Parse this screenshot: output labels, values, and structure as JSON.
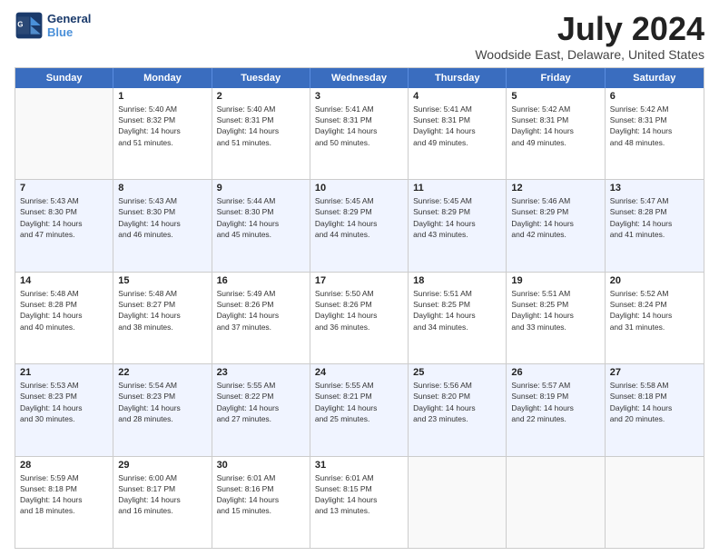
{
  "logo": {
    "line1": "General",
    "line2": "Blue"
  },
  "title": "July 2024",
  "subtitle": "Woodside East, Delaware, United States",
  "days_of_week": [
    "Sunday",
    "Monday",
    "Tuesday",
    "Wednesday",
    "Thursday",
    "Friday",
    "Saturday"
  ],
  "weeks": [
    [
      {
        "day": "",
        "sunrise": "",
        "sunset": "",
        "daylight": "",
        "empty": true
      },
      {
        "day": "1",
        "sunrise": "Sunrise: 5:40 AM",
        "sunset": "Sunset: 8:32 PM",
        "daylight": "Daylight: 14 hours",
        "dl2": "and 51 minutes."
      },
      {
        "day": "2",
        "sunrise": "Sunrise: 5:40 AM",
        "sunset": "Sunset: 8:31 PM",
        "daylight": "Daylight: 14 hours",
        "dl2": "and 51 minutes."
      },
      {
        "day": "3",
        "sunrise": "Sunrise: 5:41 AM",
        "sunset": "Sunset: 8:31 PM",
        "daylight": "Daylight: 14 hours",
        "dl2": "and 50 minutes."
      },
      {
        "day": "4",
        "sunrise": "Sunrise: 5:41 AM",
        "sunset": "Sunset: 8:31 PM",
        "daylight": "Daylight: 14 hours",
        "dl2": "and 49 minutes."
      },
      {
        "day": "5",
        "sunrise": "Sunrise: 5:42 AM",
        "sunset": "Sunset: 8:31 PM",
        "daylight": "Daylight: 14 hours",
        "dl2": "and 49 minutes."
      },
      {
        "day": "6",
        "sunrise": "Sunrise: 5:42 AM",
        "sunset": "Sunset: 8:31 PM",
        "daylight": "Daylight: 14 hours",
        "dl2": "and 48 minutes."
      }
    ],
    [
      {
        "day": "7",
        "sunrise": "Sunrise: 5:43 AM",
        "sunset": "Sunset: 8:30 PM",
        "daylight": "Daylight: 14 hours",
        "dl2": "and 47 minutes."
      },
      {
        "day": "8",
        "sunrise": "Sunrise: 5:43 AM",
        "sunset": "Sunset: 8:30 PM",
        "daylight": "Daylight: 14 hours",
        "dl2": "and 46 minutes."
      },
      {
        "day": "9",
        "sunrise": "Sunrise: 5:44 AM",
        "sunset": "Sunset: 8:30 PM",
        "daylight": "Daylight: 14 hours",
        "dl2": "and 45 minutes."
      },
      {
        "day": "10",
        "sunrise": "Sunrise: 5:45 AM",
        "sunset": "Sunset: 8:29 PM",
        "daylight": "Daylight: 14 hours",
        "dl2": "and 44 minutes."
      },
      {
        "day": "11",
        "sunrise": "Sunrise: 5:45 AM",
        "sunset": "Sunset: 8:29 PM",
        "daylight": "Daylight: 14 hours",
        "dl2": "and 43 minutes."
      },
      {
        "day": "12",
        "sunrise": "Sunrise: 5:46 AM",
        "sunset": "Sunset: 8:29 PM",
        "daylight": "Daylight: 14 hours",
        "dl2": "and 42 minutes."
      },
      {
        "day": "13",
        "sunrise": "Sunrise: 5:47 AM",
        "sunset": "Sunset: 8:28 PM",
        "daylight": "Daylight: 14 hours",
        "dl2": "and 41 minutes."
      }
    ],
    [
      {
        "day": "14",
        "sunrise": "Sunrise: 5:48 AM",
        "sunset": "Sunset: 8:28 PM",
        "daylight": "Daylight: 14 hours",
        "dl2": "and 40 minutes."
      },
      {
        "day": "15",
        "sunrise": "Sunrise: 5:48 AM",
        "sunset": "Sunset: 8:27 PM",
        "daylight": "Daylight: 14 hours",
        "dl2": "and 38 minutes."
      },
      {
        "day": "16",
        "sunrise": "Sunrise: 5:49 AM",
        "sunset": "Sunset: 8:26 PM",
        "daylight": "Daylight: 14 hours",
        "dl2": "and 37 minutes."
      },
      {
        "day": "17",
        "sunrise": "Sunrise: 5:50 AM",
        "sunset": "Sunset: 8:26 PM",
        "daylight": "Daylight: 14 hours",
        "dl2": "and 36 minutes."
      },
      {
        "day": "18",
        "sunrise": "Sunrise: 5:51 AM",
        "sunset": "Sunset: 8:25 PM",
        "daylight": "Daylight: 14 hours",
        "dl2": "and 34 minutes."
      },
      {
        "day": "19",
        "sunrise": "Sunrise: 5:51 AM",
        "sunset": "Sunset: 8:25 PM",
        "daylight": "Daylight: 14 hours",
        "dl2": "and 33 minutes."
      },
      {
        "day": "20",
        "sunrise": "Sunrise: 5:52 AM",
        "sunset": "Sunset: 8:24 PM",
        "daylight": "Daylight: 14 hours",
        "dl2": "and 31 minutes."
      }
    ],
    [
      {
        "day": "21",
        "sunrise": "Sunrise: 5:53 AM",
        "sunset": "Sunset: 8:23 PM",
        "daylight": "Daylight: 14 hours",
        "dl2": "and 30 minutes."
      },
      {
        "day": "22",
        "sunrise": "Sunrise: 5:54 AM",
        "sunset": "Sunset: 8:23 PM",
        "daylight": "Daylight: 14 hours",
        "dl2": "and 28 minutes."
      },
      {
        "day": "23",
        "sunrise": "Sunrise: 5:55 AM",
        "sunset": "Sunset: 8:22 PM",
        "daylight": "Daylight: 14 hours",
        "dl2": "and 27 minutes."
      },
      {
        "day": "24",
        "sunrise": "Sunrise: 5:55 AM",
        "sunset": "Sunset: 8:21 PM",
        "daylight": "Daylight: 14 hours",
        "dl2": "and 25 minutes."
      },
      {
        "day": "25",
        "sunrise": "Sunrise: 5:56 AM",
        "sunset": "Sunset: 8:20 PM",
        "daylight": "Daylight: 14 hours",
        "dl2": "and 23 minutes."
      },
      {
        "day": "26",
        "sunrise": "Sunrise: 5:57 AM",
        "sunset": "Sunset: 8:19 PM",
        "daylight": "Daylight: 14 hours",
        "dl2": "and 22 minutes."
      },
      {
        "day": "27",
        "sunrise": "Sunrise: 5:58 AM",
        "sunset": "Sunset: 8:18 PM",
        "daylight": "Daylight: 14 hours",
        "dl2": "and 20 minutes."
      }
    ],
    [
      {
        "day": "28",
        "sunrise": "Sunrise: 5:59 AM",
        "sunset": "Sunset: 8:18 PM",
        "daylight": "Daylight: 14 hours",
        "dl2": "and 18 minutes."
      },
      {
        "day": "29",
        "sunrise": "Sunrise: 6:00 AM",
        "sunset": "Sunset: 8:17 PM",
        "daylight": "Daylight: 14 hours",
        "dl2": "and 16 minutes."
      },
      {
        "day": "30",
        "sunrise": "Sunrise: 6:01 AM",
        "sunset": "Sunset: 8:16 PM",
        "daylight": "Daylight: 14 hours",
        "dl2": "and 15 minutes."
      },
      {
        "day": "31",
        "sunrise": "Sunrise: 6:01 AM",
        "sunset": "Sunset: 8:15 PM",
        "daylight": "Daylight: 14 hours",
        "dl2": "and 13 minutes."
      },
      {
        "day": "",
        "sunrise": "",
        "sunset": "",
        "daylight": "",
        "dl2": "",
        "empty": true
      },
      {
        "day": "",
        "sunrise": "",
        "sunset": "",
        "daylight": "",
        "dl2": "",
        "empty": true
      },
      {
        "day": "",
        "sunrise": "",
        "sunset": "",
        "daylight": "",
        "dl2": "",
        "empty": true
      }
    ]
  ]
}
